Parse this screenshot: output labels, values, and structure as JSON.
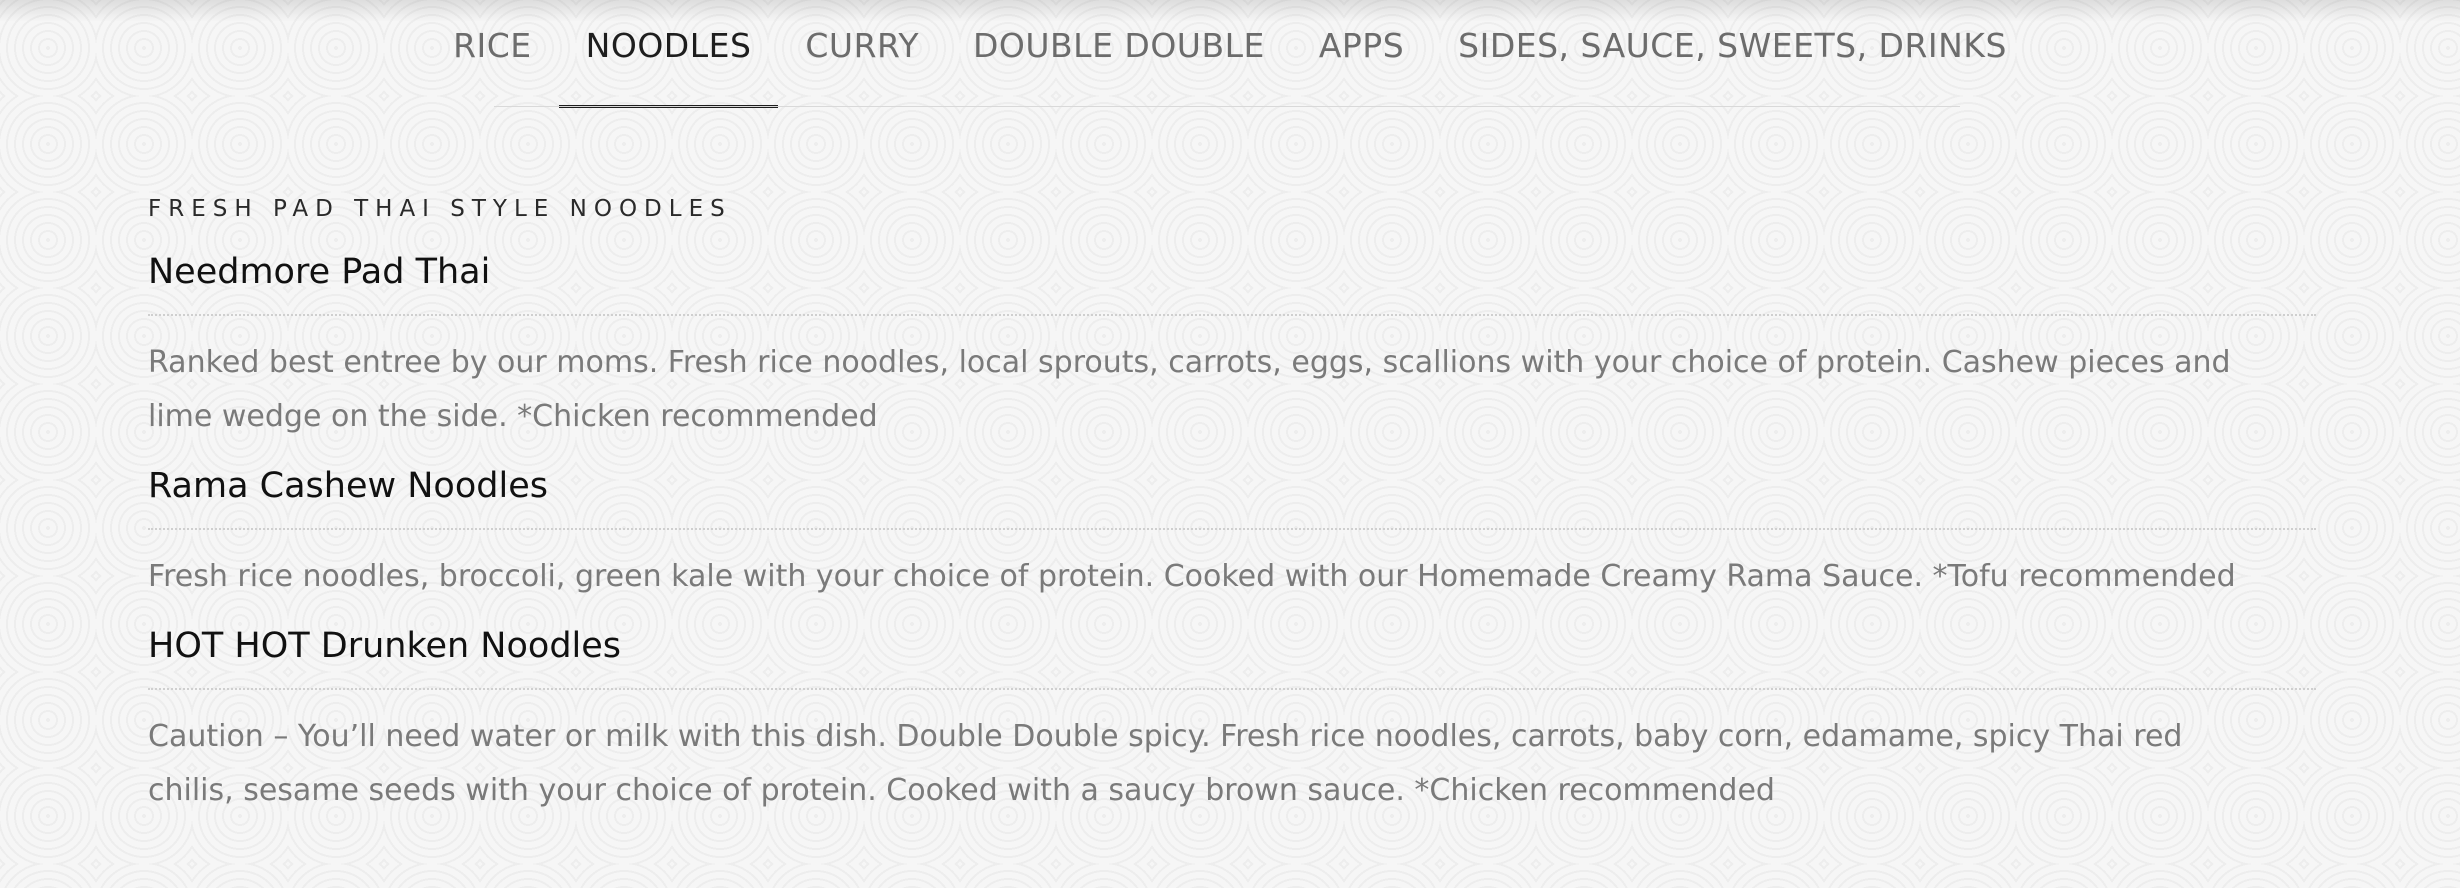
{
  "nav": {
    "tabs": [
      {
        "label": "RICE"
      },
      {
        "label": "NOODLES"
      },
      {
        "label": "CURRY"
      },
      {
        "label": "DOUBLE DOUBLE"
      },
      {
        "label": "APPS"
      },
      {
        "label": "SIDES, SAUCE, SWEETS, DRINKS"
      }
    ],
    "active_index": 1
  },
  "section": {
    "title": "FRESH PAD THAI STYLE NOODLES",
    "items": [
      {
        "name": "Needmore Pad Thai",
        "description": "Ranked best entree by our moms. Fresh rice noodles, local sprouts, carrots, eggs, scallions with your choice of protein. Cashew pieces and lime wedge on the side. *Chicken recommended"
      },
      {
        "name": "Rama Cashew Noodles",
        "description": "Fresh rice noodles, broccoli, green kale with your choice of protein. Cooked with our Homemade Creamy Rama Sauce. *Tofu recommended"
      },
      {
        "name": "HOT HOT Drunken Noodles",
        "description": "Caution – You’ll need water or milk with this dish. Double Double spicy. Fresh rice noodles, carrots, baby corn, edamame, spicy Thai red chilis, sesame seeds with your choice of protein. Cooked with a saucy brown sauce. *Chicken recommended"
      }
    ]
  },
  "colors": {
    "background": "#f6f6f6",
    "text_dark": "#111111",
    "text_muted": "#7a7a7a",
    "tab_inactive": "#6c6c6c",
    "active_underline": "#1e1e1e"
  }
}
